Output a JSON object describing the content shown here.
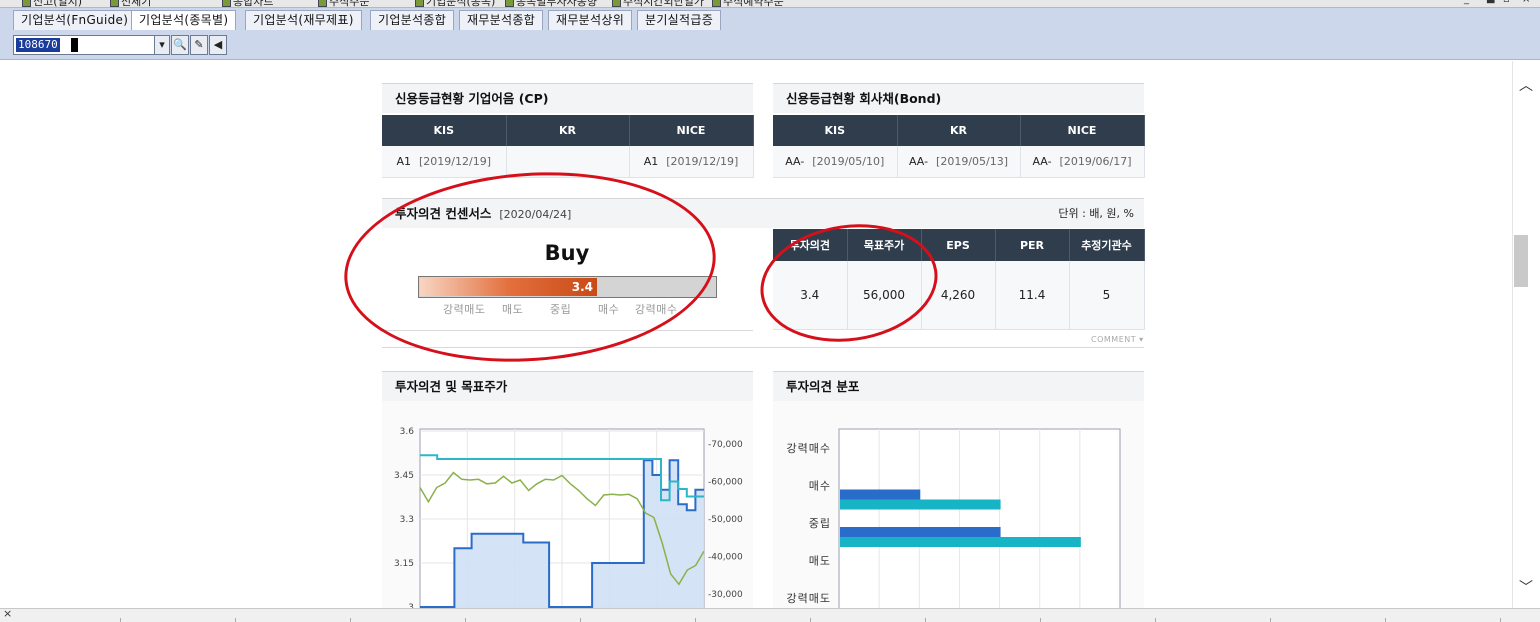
{
  "window_tabs": [
    {
      "label": "신고(일지)"
    },
    {
      "label": "전체기"
    },
    {
      "label": "종합차트"
    },
    {
      "label": "주식주문"
    },
    {
      "label": "기업분석(종목)"
    },
    {
      "label": "종목별투자자동향"
    },
    {
      "label": "주식시간외단일가"
    },
    {
      "label": "주식예약주문"
    }
  ],
  "tabs": [
    {
      "label": "기업분석(FnGuide)"
    },
    {
      "label": "기업분석(종목별)"
    },
    {
      "label": "기업분석(재무제표)"
    },
    {
      "label": "기업분석종합"
    },
    {
      "label": "재무분석종합"
    },
    {
      "label": "재무분석상위"
    },
    {
      "label": "분기실적급증"
    }
  ],
  "toolbar": {
    "stock_code": "108670"
  },
  "credit_cp": {
    "title": "신용등급현황 기업어음 (CP)",
    "headers": [
      "KIS",
      "KR",
      "NICE"
    ],
    "cells": [
      {
        "grade": "A1",
        "date": "[2019/12/19]"
      },
      {
        "grade": "",
        "date": ""
      },
      {
        "grade": "A1",
        "date": "[2019/12/19]"
      }
    ]
  },
  "credit_bond": {
    "title": "신용등급현황 회사채(Bond)",
    "headers": [
      "KIS",
      "KR",
      "NICE"
    ],
    "cells": [
      {
        "grade": "AA-",
        "date": "[2019/05/10]"
      },
      {
        "grade": "AA-",
        "date": "[2019/05/13]"
      },
      {
        "grade": "AA-",
        "date": "[2019/06/17]"
      }
    ]
  },
  "consensus": {
    "title": "투자의견 컨센서스",
    "date": "[2020/04/24]",
    "unit": "단위 : 배, 원, %",
    "opinion_label": "Buy",
    "gauge_value": 3.4,
    "gauge_value_text": "3.4",
    "gauge_min": 1,
    "gauge_max": 5,
    "scale_labels": [
      "강력매도",
      "매도",
      "중립",
      "매수",
      "강력매수"
    ],
    "headers": [
      "투자의견",
      "목표주가",
      "EPS",
      "PER",
      "추정기관수"
    ],
    "values": [
      "3.4",
      "56,000",
      "4,260",
      "11.4",
      "5"
    ],
    "comment_label": "COMMENT",
    "annotation_color": "#d6101a"
  },
  "opinion_price_chart": {
    "title": "투자의견 및 목표주가"
  },
  "distribution_chart": {
    "title": "투자의견 분포"
  },
  "chart_data": [
    {
      "type": "line",
      "title": "투자의견 및 목표주가",
      "left_axis": {
        "ticks": [
          "3.6",
          "3.45",
          "3.3",
          "3.15",
          "3"
        ],
        "range": [
          3.0,
          3.6
        ]
      },
      "right_axis": {
        "ticks": [
          "70,000",
          "60,000",
          "50,000",
          "40,000",
          "30,000"
        ],
        "range": [
          26000,
          74000
        ]
      },
      "series": [
        {
          "role": "opinion",
          "axis": "left",
          "color": "#2a6cc9",
          "values": [
            3.0,
            3.0,
            3.0,
            3.0,
            3.2,
            3.2,
            3.25,
            3.25,
            3.25,
            3.25,
            3.25,
            3.25,
            3.22,
            3.22,
            3.22,
            3.0,
            3.0,
            3.0,
            3.0,
            3.0,
            3.15,
            3.15,
            3.15,
            3.15,
            3.15,
            3.15,
            3.5,
            3.45,
            3.4,
            3.5,
            3.35,
            3.33,
            3.4
          ]
        },
        {
          "role": "target_price",
          "axis": "right",
          "color": "#2db6c8",
          "values": [
            67000,
            67000,
            66000,
            66000,
            66000,
            66000,
            66000,
            66000,
            66000,
            66000,
            66000,
            66000,
            66000,
            66000,
            66000,
            66000,
            66000,
            66000,
            66000,
            66000,
            66000,
            66000,
            66000,
            66000,
            66000,
            66000,
            66000,
            66000,
            55000,
            60000,
            58000,
            56000,
            56000
          ]
        },
        {
          "role": "stock_price",
          "axis": "right",
          "color": "#8cb04a",
          "values": [
            58000,
            55000,
            58000,
            60000,
            62000,
            61000,
            60000,
            61000,
            59000,
            60000,
            61000,
            60000,
            60000,
            58000,
            59000,
            61000,
            60000,
            62000,
            59000,
            58000,
            55000,
            54000,
            56000,
            57000,
            56000,
            57000,
            55000,
            52000,
            50000,
            44000,
            35000,
            33000,
            36000,
            38000,
            41000
          ]
        }
      ]
    },
    {
      "type": "bar",
      "orientation": "horizontal",
      "title": "투자의견 분포",
      "categories": [
        "강력매수",
        "매수",
        "중립",
        "매도",
        "강력매도"
      ],
      "series": [
        {
          "color": "#2a6cc9",
          "values": [
            0,
            2,
            4,
            0,
            0
          ]
        },
        {
          "color": "#17b4c6",
          "values": [
            0,
            4,
            6,
            0,
            0
          ]
        }
      ],
      "xlim": [
        0,
        7
      ]
    }
  ]
}
